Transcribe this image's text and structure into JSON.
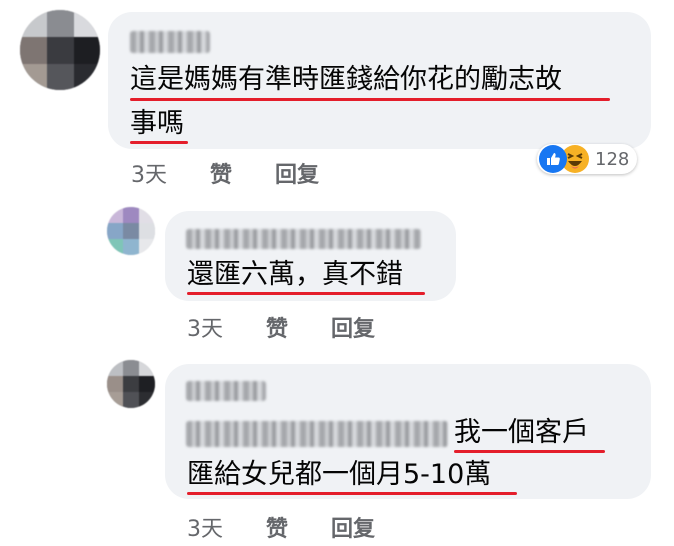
{
  "comments": [
    {
      "text_lines": [
        "這是媽媽有準時匯錢給你花的勵志故",
        "事嗎"
      ],
      "time": "3天",
      "like_label": "赞",
      "reply_label": "回复",
      "reactions": {
        "icons": [
          "like-icon",
          "haha-icon"
        ],
        "count": "128"
      }
    },
    {
      "text_lines": [
        "還匯六萬，真不錯"
      ],
      "time": "3天",
      "like_label": "赞",
      "reply_label": "回复"
    },
    {
      "text_lines": [
        "我一個客戶",
        "匯給女兒都一個月5-10萬"
      ],
      "time": "3天",
      "like_label": "赞",
      "reply_label": "回复"
    }
  ],
  "colors": {
    "bubble": "#f0f2f5",
    "underline": "#e41e2b",
    "meta": "#65676b",
    "like_blue": "#1877f2",
    "haha_yellow": "#f7b125"
  }
}
